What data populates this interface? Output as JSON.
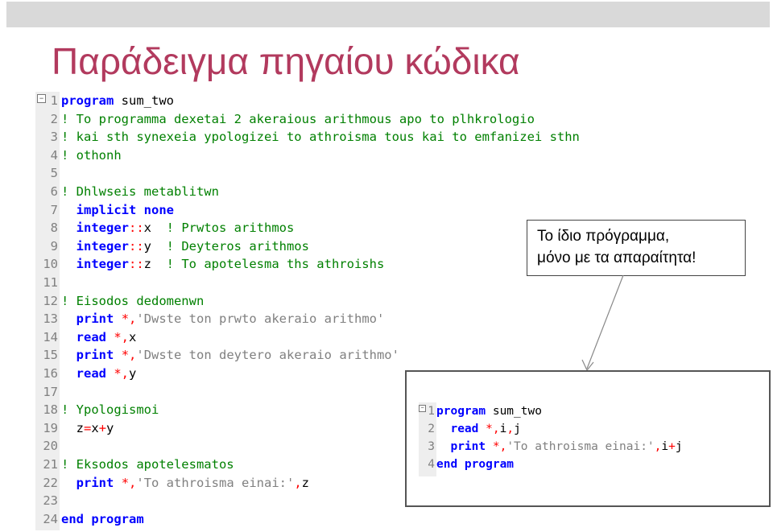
{
  "slide": {
    "title": "Παράδειγμα πηγαίου κώδικα",
    "callout_line1": "Το ίδιο πρόγραμμα,",
    "callout_line2": "μόνο με τα απαραίτητα!"
  },
  "colors": {
    "title": "#b23a5e",
    "keyword": "#0000ff",
    "comment": "#008000",
    "operator": "#ff0000",
    "string": "#808080"
  },
  "code_main": [
    {
      "n": "1",
      "tokens": [
        [
          "kw",
          "program"
        ],
        [
          "id",
          " sum_two"
        ]
      ]
    },
    {
      "n": "2",
      "tokens": [
        [
          "cm",
          "! To programma dexetai 2 akeraious arithmous apo to plhkrologio"
        ]
      ]
    },
    {
      "n": "3",
      "tokens": [
        [
          "cm",
          "! kai sth synexeia ypologizei to athroisma tous kai to emfanizei sthn"
        ]
      ]
    },
    {
      "n": "4",
      "tokens": [
        [
          "cm",
          "! othonh"
        ]
      ]
    },
    {
      "n": "5",
      "tokens": []
    },
    {
      "n": "6",
      "tokens": [
        [
          "cm",
          "! Dhlwseis metablitwn"
        ]
      ]
    },
    {
      "n": "7",
      "tokens": [
        [
          "id",
          "  "
        ],
        [
          "kw",
          "implicit none"
        ]
      ]
    },
    {
      "n": "8",
      "tokens": [
        [
          "id",
          "  "
        ],
        [
          "kw",
          "integer"
        ],
        [
          "op",
          "::"
        ],
        [
          "id",
          "x  "
        ],
        [
          "cm",
          "! Prwtos arithmos"
        ]
      ]
    },
    {
      "n": "9",
      "tokens": [
        [
          "id",
          "  "
        ],
        [
          "kw",
          "integer"
        ],
        [
          "op",
          "::"
        ],
        [
          "id",
          "y  "
        ],
        [
          "cm",
          "! Deyteros arithmos"
        ]
      ]
    },
    {
      "n": "10",
      "tokens": [
        [
          "id",
          "  "
        ],
        [
          "kw",
          "integer"
        ],
        [
          "op",
          "::"
        ],
        [
          "id",
          "z  "
        ],
        [
          "cm",
          "! To apotelesma ths athroishs"
        ]
      ]
    },
    {
      "n": "11",
      "tokens": []
    },
    {
      "n": "12",
      "tokens": [
        [
          "cm",
          "! Eisodos dedomenwn"
        ]
      ]
    },
    {
      "n": "13",
      "tokens": [
        [
          "id",
          "  "
        ],
        [
          "kw",
          "print"
        ],
        [
          "id",
          " "
        ],
        [
          "op",
          "*,"
        ],
        [
          "st",
          "'Dwste ton prwto akeraio arithmo'"
        ]
      ]
    },
    {
      "n": "14",
      "tokens": [
        [
          "id",
          "  "
        ],
        [
          "kw",
          "read"
        ],
        [
          "id",
          " "
        ],
        [
          "op",
          "*,"
        ],
        [
          "id",
          "x"
        ]
      ]
    },
    {
      "n": "15",
      "tokens": [
        [
          "id",
          "  "
        ],
        [
          "kw",
          "print"
        ],
        [
          "id",
          " "
        ],
        [
          "op",
          "*,"
        ],
        [
          "st",
          "'Dwste ton deytero akeraio arithmo'"
        ]
      ]
    },
    {
      "n": "16",
      "tokens": [
        [
          "id",
          "  "
        ],
        [
          "kw",
          "read"
        ],
        [
          "id",
          " "
        ],
        [
          "op",
          "*,"
        ],
        [
          "id",
          "y"
        ]
      ]
    },
    {
      "n": "17",
      "tokens": []
    },
    {
      "n": "18",
      "tokens": [
        [
          "cm",
          "! Ypologismoi"
        ]
      ]
    },
    {
      "n": "19",
      "tokens": [
        [
          "id",
          "  z"
        ],
        [
          "op",
          "="
        ],
        [
          "id",
          "x"
        ],
        [
          "op",
          "+"
        ],
        [
          "id",
          "y"
        ]
      ]
    },
    {
      "n": "20",
      "tokens": []
    },
    {
      "n": "21",
      "tokens": [
        [
          "cm",
          "! Eksodos apotelesmatos"
        ]
      ]
    },
    {
      "n": "22",
      "tokens": [
        [
          "id",
          "  "
        ],
        [
          "kw",
          "print"
        ],
        [
          "id",
          " "
        ],
        [
          "op",
          "*,"
        ],
        [
          "st",
          "'To athroisma einai:'"
        ],
        [
          "op",
          ","
        ],
        [
          "id",
          "z"
        ]
      ]
    },
    {
      "n": "23",
      "tokens": []
    },
    {
      "n": "24",
      "tokens": [
        [
          "kw",
          "end program"
        ]
      ]
    }
  ],
  "code_short": [
    {
      "n": "1",
      "tokens": [
        [
          "kw",
          "program"
        ],
        [
          "id",
          " sum_two"
        ]
      ]
    },
    {
      "n": "2",
      "tokens": [
        [
          "id",
          "  "
        ],
        [
          "kw",
          "read"
        ],
        [
          "id",
          " "
        ],
        [
          "op",
          "*,"
        ],
        [
          "id",
          "i"
        ],
        [
          "op",
          ","
        ],
        [
          "id",
          "j"
        ]
      ]
    },
    {
      "n": "3",
      "tokens": [
        [
          "id",
          "  "
        ],
        [
          "kw",
          "print"
        ],
        [
          "id",
          " "
        ],
        [
          "op",
          "*,"
        ],
        [
          "st",
          "'To athroisma einai:'"
        ],
        [
          "op",
          ","
        ],
        [
          "id",
          "i"
        ],
        [
          "op",
          "+"
        ],
        [
          "id",
          "j"
        ]
      ]
    },
    {
      "n": "4",
      "tokens": [
        [
          "kw",
          "end program"
        ]
      ]
    }
  ]
}
